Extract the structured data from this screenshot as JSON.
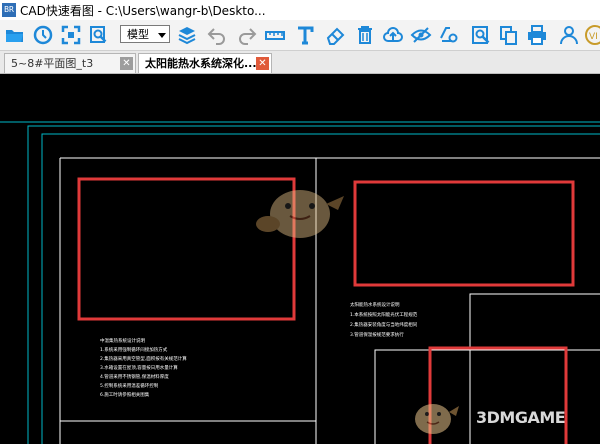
{
  "window": {
    "app_icon_text": "BR",
    "title": "CAD快速看图 - C:\\Users\\wangr-b\\Deskto..."
  },
  "toolbar": {
    "icons": [
      "open-folder-icon",
      "history-icon",
      "zoom-extents-icon",
      "zoom-window-icon",
      "layers-icon",
      "undo-icon",
      "redo-icon",
      "measure-icon",
      "text-icon",
      "eraser-icon",
      "delete-icon",
      "cloud-upload-icon",
      "hide-icon",
      "settings-icon",
      "search-text-icon",
      "copy-icon",
      "print-icon",
      "user-icon",
      "vip-icon"
    ],
    "mode_select": {
      "value": "模型"
    }
  },
  "tabs": [
    {
      "label": "5~8#平面图_t3",
      "active": false
    },
    {
      "label": "太阳能热水系统深化...",
      "active": true
    }
  ],
  "drawing": {
    "notes_left": [
      "中温集热系统设计说明",
      "1.系统采用强制循环间接加热方式",
      "2.集热器采用真空管型,面积按有关规范计算",
      "3.水箱设置在屋顶,容量按日用水量计算",
      "4.管道采用不锈钢管,保温材料厚度",
      "5.控制系统采用温差循环控制",
      "6.施工时请参照相关图集"
    ],
    "notes_right": [
      "太阳能热水系统设计说明",
      "1.本系统按照太阳能光伏工程规范",
      "2.集热器安装角度与当地纬度相同",
      "3.管道保温按规范要求执行"
    ],
    "colors": {
      "frame_outer": "#00b8c8",
      "lines": "#ffffff",
      "highlight": "#e03a3a",
      "background": "#000000"
    },
    "watermark": "3DMGAME"
  }
}
